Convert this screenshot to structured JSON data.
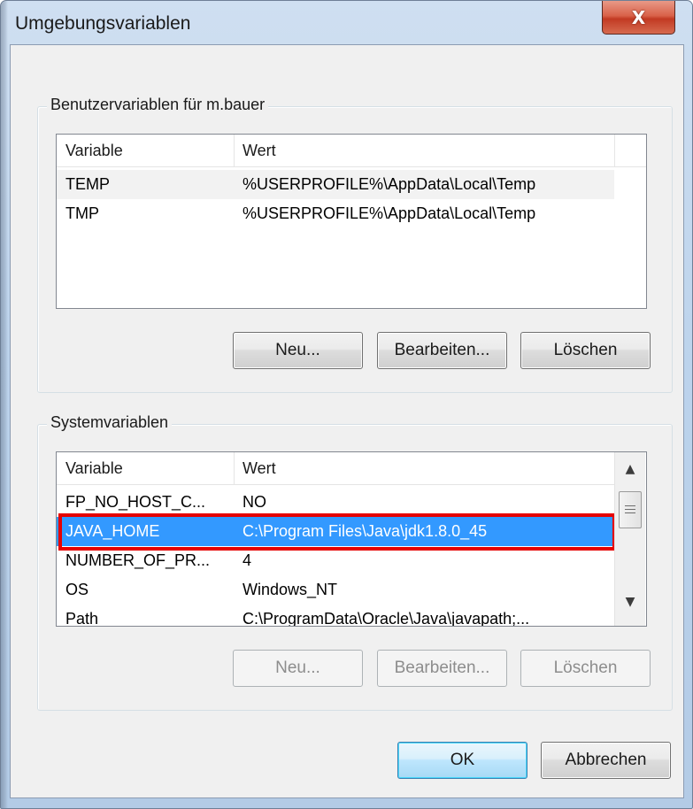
{
  "window": {
    "title": "Umgebungsvariablen",
    "close_glyph": "X"
  },
  "user_group": {
    "label": "Benutzervariablen für m.bauer",
    "columns": [
      "Variable",
      "Wert"
    ],
    "rows": [
      {
        "variable": "TEMP",
        "value": "%USERPROFILE%\\AppData\\Local\\Temp"
      },
      {
        "variable": "TMP",
        "value": "%USERPROFILE%\\AppData\\Local\\Temp"
      }
    ],
    "buttons": {
      "new": "Neu...",
      "edit": "Bearbeiten...",
      "delete": "Löschen"
    }
  },
  "system_group": {
    "label": "Systemvariablen",
    "columns": [
      "Variable",
      "Wert"
    ],
    "rows": [
      {
        "variable": "FP_NO_HOST_C...",
        "value": "NO"
      },
      {
        "variable": "JAVA_HOME",
        "value": "C:\\Program Files\\Java\\jdk1.8.0_45",
        "selected": true
      },
      {
        "variable": "NUMBER_OF_PR...",
        "value": "4"
      },
      {
        "variable": "OS",
        "value": "Windows_NT"
      },
      {
        "variable": "Path",
        "value": "C:\\ProgramData\\Oracle\\Java\\javapath;..."
      }
    ],
    "buttons": {
      "new": "Neu...",
      "edit": "Bearbeiten...",
      "delete": "Löschen"
    }
  },
  "footer": {
    "ok": "OK",
    "cancel": "Abbrechen"
  },
  "icons": {
    "close": "close-icon",
    "scroll_up": "arrow-up-icon",
    "scroll_down": "arrow-down-icon",
    "thumb_grip": "grip-icon"
  },
  "colors": {
    "selection": "#3399ff",
    "annotation_box": "#e60000",
    "close_button": "#c23a23"
  }
}
